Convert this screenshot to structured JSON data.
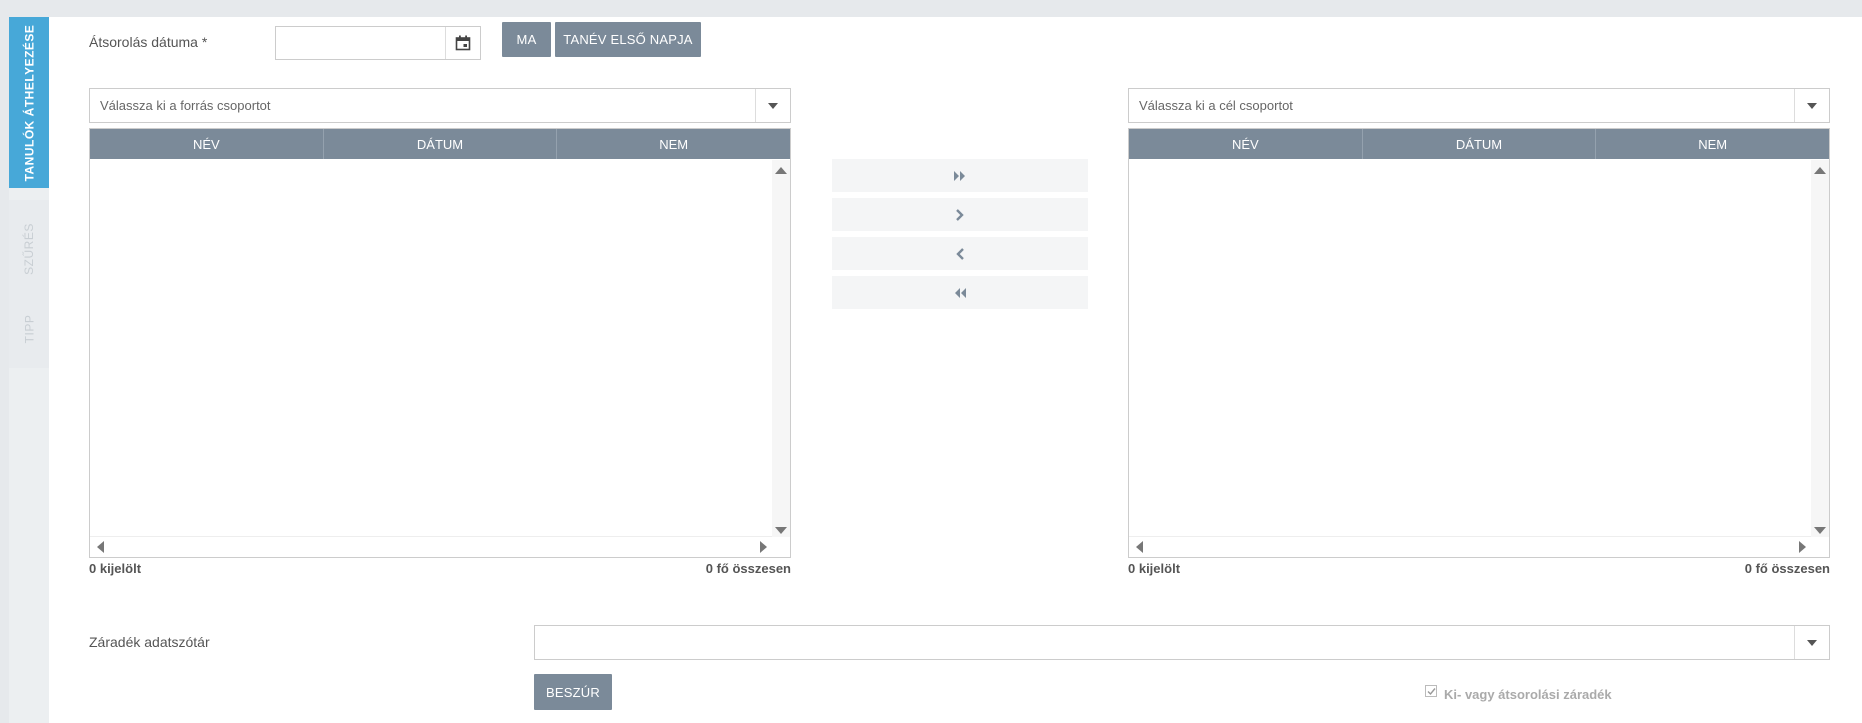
{
  "side_tabs": {
    "active": "TANULÓK ÁTHELYEZÉSE",
    "filter": "SZŰRÉS",
    "tip": "TIPP"
  },
  "form": {
    "date_label": "Átsorolás dátuma *",
    "date_value": "",
    "today_button": "MA",
    "first_day_button": "TANÉV ELSŐ NAPJA"
  },
  "source": {
    "placeholder": "Válassza ki a forrás csoportot",
    "columns": [
      "NÉV",
      "DÁTUM",
      "NEM"
    ],
    "selected_text": "0 kijelölt",
    "total_text": "0 fő összesen"
  },
  "target": {
    "placeholder": "Válassza ki a cél csoportot",
    "columns": [
      "NÉV",
      "DÁTUM",
      "NEM"
    ],
    "selected_text": "0 kijelölt",
    "total_text": "0 fő összesen"
  },
  "move_buttons": {
    "move_all_right": "⏩",
    "move_right": "›",
    "move_left": "‹",
    "move_all_left": "⏪"
  },
  "clause": {
    "label": "Záradék adatszótár",
    "value": "",
    "insert_button": "BESZÚR",
    "checkbox_label": "Ki- vagy átsorolási záradék",
    "checkbox_checked": true
  },
  "colors": {
    "accent": "#47a8d8",
    "button": "#7b8a99"
  }
}
